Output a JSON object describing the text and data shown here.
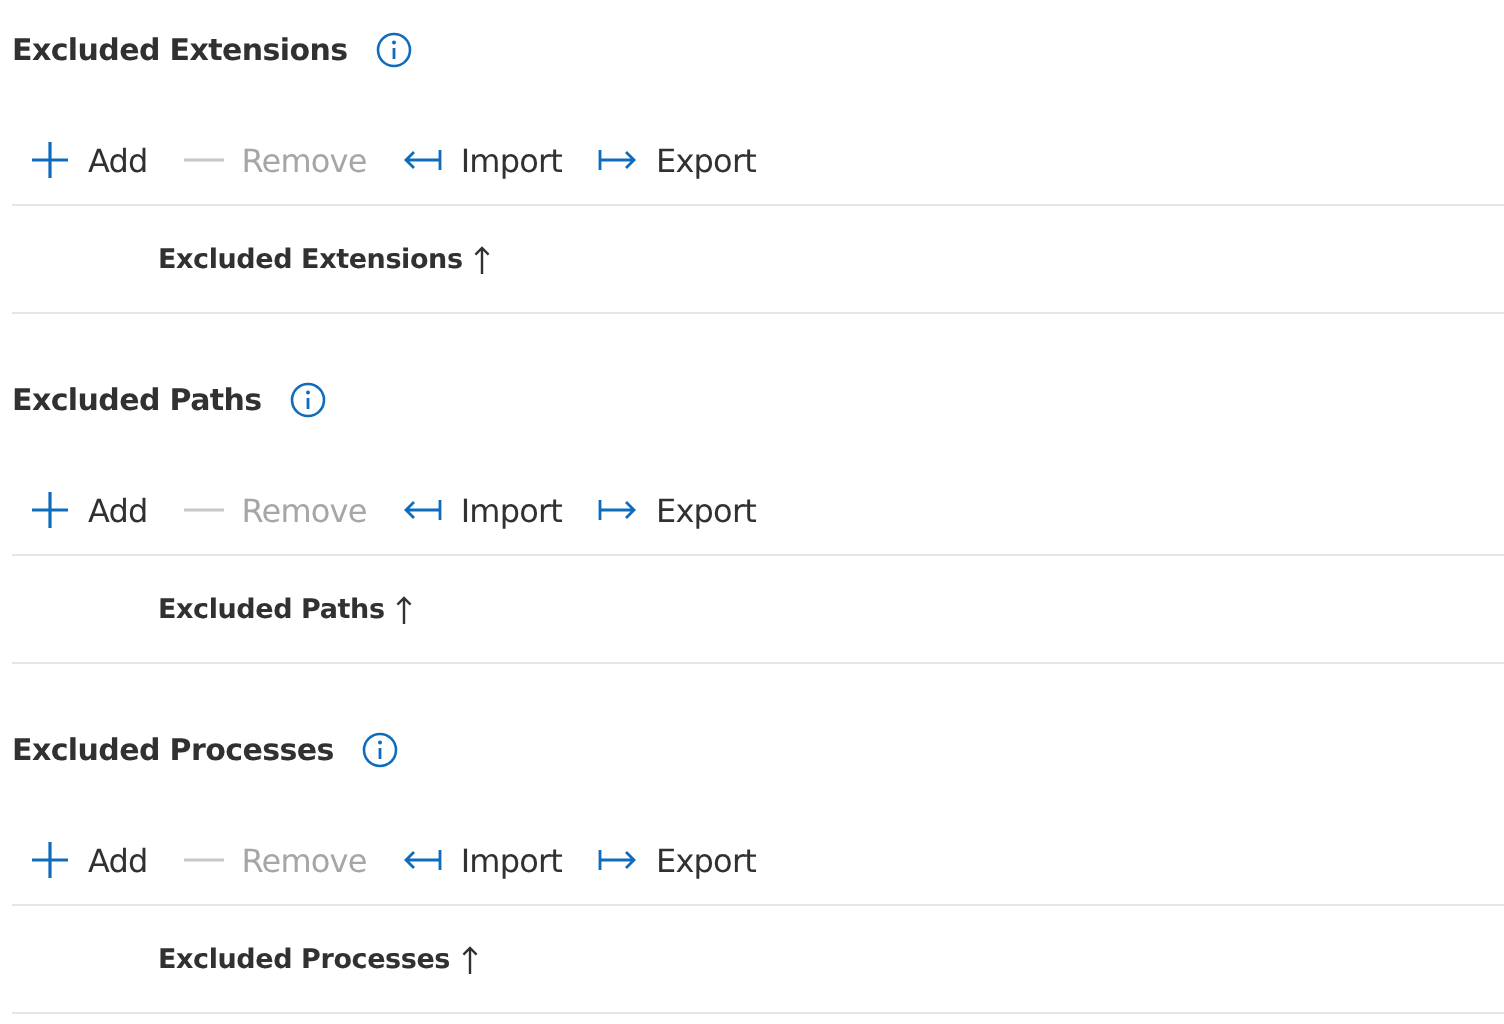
{
  "sections": [
    {
      "title": "Excluded Extensions",
      "actions": [
        {
          "kind": "add",
          "label": "Add",
          "disabled": false
        },
        {
          "kind": "remove",
          "label": "Remove",
          "disabled": true
        },
        {
          "kind": "import",
          "label": "Import",
          "disabled": false
        },
        {
          "kind": "export",
          "label": "Export",
          "disabled": false
        }
      ],
      "column": {
        "label": "Excluded Extensions",
        "sorted_ascending": true
      }
    },
    {
      "title": "Excluded Paths",
      "actions": [
        {
          "kind": "add",
          "label": "Add",
          "disabled": false
        },
        {
          "kind": "remove",
          "label": "Remove",
          "disabled": true
        },
        {
          "kind": "import",
          "label": "Import",
          "disabled": false
        },
        {
          "kind": "export",
          "label": "Export",
          "disabled": false
        }
      ],
      "column": {
        "label": "Excluded Paths",
        "sorted_ascending": true
      }
    },
    {
      "title": "Excluded Processes",
      "actions": [
        {
          "kind": "add",
          "label": "Add",
          "disabled": false
        },
        {
          "kind": "remove",
          "label": "Remove",
          "disabled": true
        },
        {
          "kind": "import",
          "label": "Import",
          "disabled": false
        },
        {
          "kind": "export",
          "label": "Export",
          "disabled": false
        }
      ],
      "column": {
        "label": "Excluded Processes",
        "sorted_ascending": true
      }
    }
  ]
}
